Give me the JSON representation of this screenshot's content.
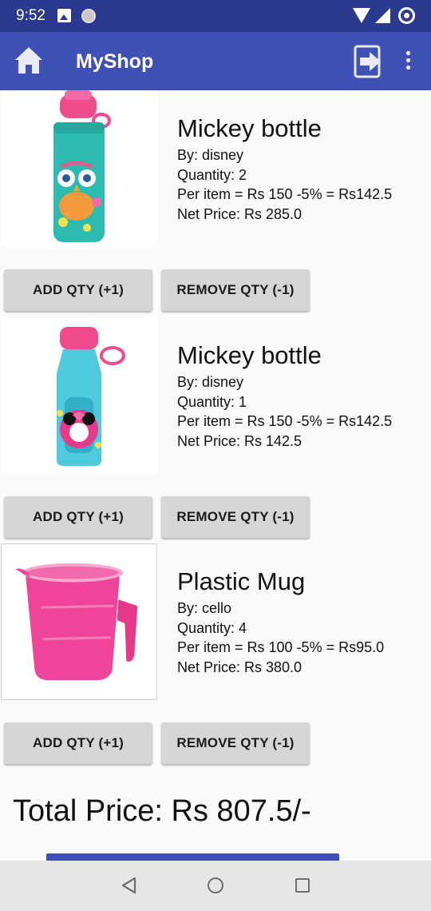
{
  "status_bar": {
    "time": "9:52",
    "icons": [
      "image-notification-icon",
      "circle-notification-icon",
      "wifi-icon",
      "signal-icon",
      "sync-icon"
    ]
  },
  "toolbar": {
    "title": "MyShop",
    "background": "#3f51b5",
    "icons": [
      "home-icon",
      "logout-icon",
      "overflow-menu-icon"
    ]
  },
  "cart": {
    "items": [
      {
        "name": "Mickey bottle",
        "brand": "By: disney",
        "quantity": "Quantity: 2",
        "per_item": "Per item = Rs 150 -5%  = Rs142.5",
        "net_price": "Net Price: Rs 285.0",
        "image": "pink-owl-bottle",
        "add_label": "ADD QTY (+1)",
        "remove_label": "REMOVE QTY (-1)"
      },
      {
        "name": "Mickey bottle",
        "brand": "By: disney",
        "quantity": "Quantity: 1",
        "per_item": "Per item = Rs 150 -5%  = Rs142.5",
        "net_price": "Net Price: Rs 142.5",
        "image": "minnie-bottle",
        "add_label": "ADD QTY (+1)",
        "remove_label": "REMOVE QTY (-1)"
      },
      {
        "name": "Plastic Mug",
        "brand": "By: cello",
        "quantity": "Quantity: 4",
        "per_item": "Per item = Rs 100 -5%  = Rs95.0",
        "net_price": "Net Price: Rs 380.0",
        "image": "pink-plastic-mug",
        "add_label": "ADD QTY (+1)",
        "remove_label": "REMOVE QTY (-1)"
      }
    ],
    "total": "Total Price: Rs 807.5/-"
  },
  "nav_bar": {
    "icons": [
      "back-icon",
      "home-nav-icon",
      "recents-icon"
    ]
  }
}
